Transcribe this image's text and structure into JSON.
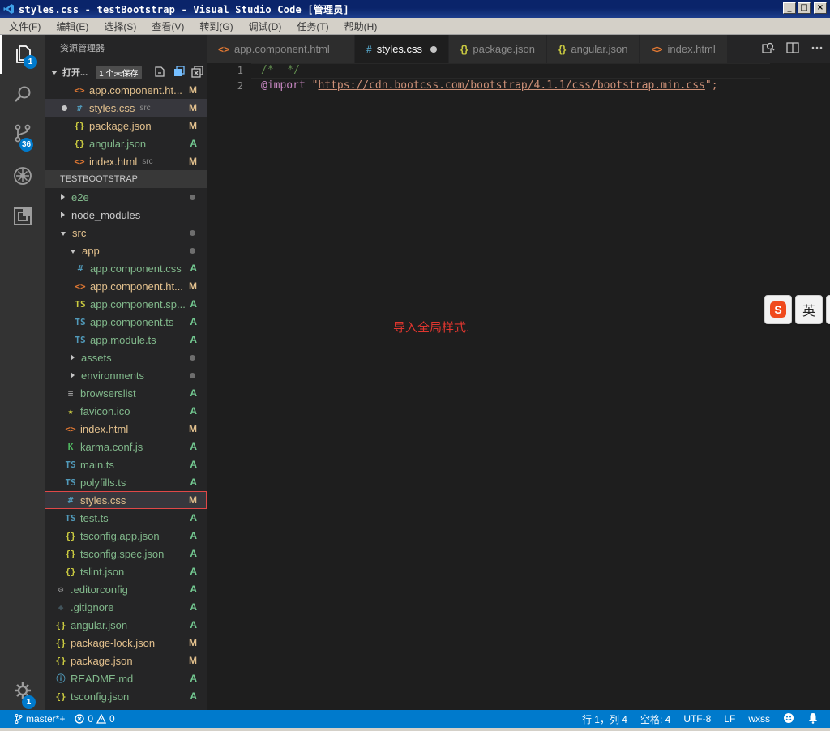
{
  "window": {
    "title": "styles.css - testBootstrap - Visual Studio Code [管理员]",
    "minimize_glyph": "_",
    "maximize_glyph": "□",
    "close_glyph": "×"
  },
  "menu": [
    "文件(F)",
    "编辑(E)",
    "选择(S)",
    "查看(V)",
    "转到(G)",
    "调试(D)",
    "任务(T)",
    "帮助(H)"
  ],
  "activity": {
    "explorer_badge": "1",
    "scm_badge": "36",
    "settings_badge": "1"
  },
  "sidebar": {
    "title": "资源管理器",
    "open_editors": {
      "label": "打开...",
      "unsaved_badge": "1 个未保存",
      "items": [
        {
          "icon": "<>",
          "icon_color": "#e37933",
          "name": "app.component.ht...",
          "subdir": "",
          "status": "M",
          "color": "mod"
        },
        {
          "icon": "#",
          "icon_color": "#519aba",
          "name": "styles.css",
          "subdir": "src",
          "status": "M",
          "color": "mod"
        },
        {
          "icon": "{}",
          "icon_color": "#cbcb41",
          "name": "package.json",
          "subdir": "",
          "status": "M",
          "color": "mod"
        },
        {
          "icon": "{}",
          "icon_color": "#cbcb41",
          "name": "angular.json",
          "subdir": "",
          "status": "A",
          "color": "add"
        },
        {
          "icon": "<>",
          "icon_color": "#e37933",
          "name": "index.html",
          "subdir": "src",
          "status": "M",
          "color": "mod"
        }
      ]
    },
    "project": {
      "label": "TESTBOOTSTRAP",
      "items": [
        {
          "name": "e2e",
          "type": "folder-closed",
          "depth": 0,
          "status": "dot",
          "color": "add"
        },
        {
          "name": "node_modules",
          "type": "folder-closed",
          "depth": 0,
          "status": "",
          "color": "plain"
        },
        {
          "name": "src",
          "type": "folder-open",
          "depth": 0,
          "status": "dot",
          "color": "mod"
        },
        {
          "name": "app",
          "type": "folder-open",
          "depth": 1,
          "status": "dot",
          "color": "mod"
        },
        {
          "name": "app.component.css",
          "type": "file",
          "icon": "#",
          "icon_color": "#519aba",
          "depth": 2,
          "status": "A",
          "color": "add"
        },
        {
          "name": "app.component.ht...",
          "type": "file",
          "icon": "<>",
          "icon_color": "#e37933",
          "depth": 2,
          "status": "M",
          "color": "mod"
        },
        {
          "name": "app.component.sp...",
          "type": "file",
          "icon": "TS",
          "icon_color": "#cbcb41",
          "depth": 2,
          "status": "A",
          "color": "add"
        },
        {
          "name": "app.component.ts",
          "type": "file",
          "icon": "TS",
          "icon_color": "#519aba",
          "depth": 2,
          "status": "A",
          "color": "add"
        },
        {
          "name": "app.module.ts",
          "type": "file",
          "icon": "TS",
          "icon_color": "#519aba",
          "depth": 2,
          "status": "A",
          "color": "add"
        },
        {
          "name": "assets",
          "type": "folder-closed",
          "depth": 1,
          "status": "dot",
          "color": "add"
        },
        {
          "name": "environments",
          "type": "folder-closed",
          "depth": 1,
          "status": "dot",
          "color": "add"
        },
        {
          "name": "browserslist",
          "type": "file",
          "icon": "≡",
          "icon_color": "#a0a0a0",
          "depth": 1,
          "status": "A",
          "color": "add"
        },
        {
          "name": "favicon.ico",
          "type": "file",
          "icon": "★",
          "icon_color": "#cbcb41",
          "depth": 1,
          "status": "A",
          "color": "add"
        },
        {
          "name": "index.html",
          "type": "file",
          "icon": "<>",
          "icon_color": "#e37933",
          "depth": 1,
          "status": "M",
          "color": "mod"
        },
        {
          "name": "karma.conf.js",
          "type": "file",
          "icon": "K",
          "icon_color": "#4fb860",
          "depth": 1,
          "status": "A",
          "color": "add"
        },
        {
          "name": "main.ts",
          "type": "file",
          "icon": "TS",
          "icon_color": "#519aba",
          "depth": 1,
          "status": "A",
          "color": "add"
        },
        {
          "name": "polyfills.ts",
          "type": "file",
          "icon": "TS",
          "icon_color": "#519aba",
          "depth": 1,
          "status": "A",
          "color": "add"
        },
        {
          "name": "styles.css",
          "type": "file",
          "icon": "#",
          "icon_color": "#519aba",
          "depth": 1,
          "status": "M",
          "color": "mod",
          "boxed": true
        },
        {
          "name": "test.ts",
          "type": "file",
          "icon": "TS",
          "icon_color": "#519aba",
          "depth": 1,
          "status": "A",
          "color": "add"
        },
        {
          "name": "tsconfig.app.json",
          "type": "file",
          "icon": "{}",
          "icon_color": "#cbcb41",
          "depth": 1,
          "status": "A",
          "color": "add"
        },
        {
          "name": "tsconfig.spec.json",
          "type": "file",
          "icon": "{}",
          "icon_color": "#cbcb41",
          "depth": 1,
          "status": "A",
          "color": "add"
        },
        {
          "name": "tslint.json",
          "type": "file",
          "icon": "{}",
          "icon_color": "#cbcb41",
          "depth": 1,
          "status": "A",
          "color": "add"
        },
        {
          "name": ".editorconfig",
          "type": "file",
          "icon": "⚙",
          "icon_color": "#8b8b8b",
          "depth": 0,
          "status": "A",
          "color": "add"
        },
        {
          "name": ".gitignore",
          "type": "file",
          "icon": "◆",
          "icon_color": "#41535b",
          "depth": 0,
          "status": "A",
          "color": "add"
        },
        {
          "name": "angular.json",
          "type": "file",
          "icon": "{}",
          "icon_color": "#cbcb41",
          "depth": 0,
          "status": "A",
          "color": "add"
        },
        {
          "name": "package-lock.json",
          "type": "file",
          "icon": "{}",
          "icon_color": "#cbcb41",
          "depth": 0,
          "status": "M",
          "color": "mod"
        },
        {
          "name": "package.json",
          "type": "file",
          "icon": "{}",
          "icon_color": "#cbcb41",
          "depth": 0,
          "status": "M",
          "color": "mod"
        },
        {
          "name": "README.md",
          "type": "file",
          "icon": "ⓘ",
          "icon_color": "#519aba",
          "depth": 0,
          "status": "A",
          "color": "add"
        },
        {
          "name": "tsconfig.json",
          "type": "file",
          "icon": "{}",
          "icon_color": "#cbcb41",
          "depth": 0,
          "status": "A",
          "color": "add"
        }
      ]
    }
  },
  "tabs": [
    {
      "icon": "<>",
      "icon_color": "#e37933",
      "label": "app.component.html",
      "active": false
    },
    {
      "icon": "#",
      "icon_color": "#519aba",
      "label": "styles.css",
      "active": true,
      "dirty": true
    },
    {
      "icon": "{}",
      "icon_color": "#cbcb41",
      "label": "package.json",
      "active": false
    },
    {
      "icon": "{}",
      "icon_color": "#cbcb41",
      "label": "angular.json",
      "active": false
    },
    {
      "icon": "<>",
      "icon_color": "#e37933",
      "label": "index.html",
      "active": false
    }
  ],
  "editor": {
    "lines": [
      {
        "number": "1",
        "comment_open": "/* ",
        "comment_close": " */"
      },
      {
        "number": "2",
        "keyword": "@import",
        "space": " ",
        "quote": "\"",
        "url": "https://cdn.bootcss.com/bootstrap/4.1.1/css/bootstrap.min.css",
        "end": "\";"
      }
    ],
    "annotation": "导入全局样式."
  },
  "ime": {
    "logo": "S",
    "mode": "英"
  },
  "statusbar": {
    "branch": "master*+",
    "errors": "0",
    "warnings": "0",
    "position": "行 1，列 4",
    "indent": "空格: 4",
    "encoding": "UTF-8",
    "eol": "LF",
    "language": "wxss"
  }
}
